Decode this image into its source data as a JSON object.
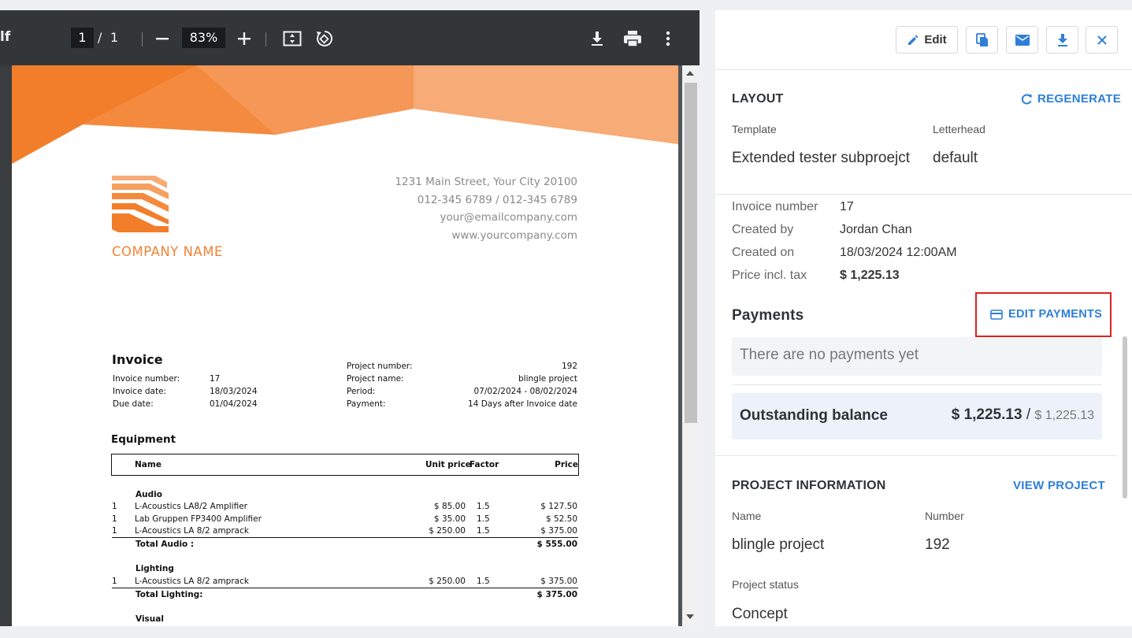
{
  "pdf_toolbar": {
    "filename_fragment": "lf",
    "page_current": "1",
    "page_separator": "/",
    "page_total": "1",
    "zoom": "83%",
    "icons": [
      "zoom-out-icon",
      "zoom-in-icon",
      "fit-page-icon",
      "rotate-icon",
      "download-icon",
      "print-icon",
      "more-options-icon"
    ]
  },
  "document": {
    "address_lines": [
      "1231 Main Street, Your City 20100",
      "012-345 6789 / 012-345 6789",
      "your@emailcompany.com",
      "www.yourcompany.com"
    ],
    "company_name": "COMPANY NAME",
    "invoice_title": "Invoice",
    "meta_left": [
      {
        "label": "Invoice number:",
        "value": "17"
      },
      {
        "label": "Invoice date:",
        "value": "18/03/2024"
      },
      {
        "label": "Due date:",
        "value": "01/04/2024"
      }
    ],
    "meta_right": [
      {
        "label": "Project number:",
        "value": "192"
      },
      {
        "label": "Project name:",
        "value": "blingle project"
      },
      {
        "label": "Period:",
        "value": "07/02/2024 - 08/02/2024"
      },
      {
        "label": "Payment:",
        "value": "14 Days after Invoice date"
      }
    ],
    "section_title": "Equipment",
    "table_headers": {
      "name": "Name",
      "unit_price": "Unit price",
      "factor": "Factor",
      "price": "Price"
    },
    "groups": [
      {
        "title": "Audio",
        "rows": [
          {
            "qty": "1",
            "name": "L-Acoustics LA8/2 Amplifier",
            "unit_price": "$ 85.00",
            "factor": "1.5",
            "price": "$ 127.50"
          },
          {
            "qty": "1",
            "name": "Lab Gruppen FP3400 Amplifier",
            "unit_price": "$ 35.00",
            "factor": "1.5",
            "price": "$ 52.50"
          },
          {
            "qty": "1",
            "name": "L-Acoustics LA 8/2 amprack",
            "unit_price": "$ 250.00",
            "factor": "1.5",
            "price": "$ 375.00"
          }
        ],
        "total_label": "Total Audio :",
        "total_value": "$ 555.00"
      },
      {
        "title": "Lighting",
        "rows": [
          {
            "qty": "1",
            "name": "L-Acoustics LA 8/2 amprack",
            "unit_price": "$ 250.00",
            "factor": "1.5",
            "price": "$ 375.00"
          }
        ],
        "total_label": "Total Lighting:",
        "total_value": "$ 375.00"
      },
      {
        "title": "Visual"
      }
    ]
  },
  "panel": {
    "buttons": {
      "edit": "Edit"
    },
    "layout": {
      "title": "LAYOUT",
      "regenerate": "REGENERATE",
      "template_label": "Template",
      "template_value": "Extended tester subproejct",
      "letterhead_label": "Letterhead",
      "letterhead_value": "default"
    },
    "details": [
      {
        "label": "Invoice number",
        "value": "17"
      },
      {
        "label": "Created by",
        "value": "Jordan Chan"
      },
      {
        "label": "Created on",
        "value": "18/03/2024 12:00AM"
      },
      {
        "label": "Price incl. tax",
        "value": "$ 1,225.13"
      }
    ],
    "payments": {
      "title": "Payments",
      "edit_payments": "EDIT PAYMENTS",
      "empty_text": "There are no payments yet",
      "outstanding_label": "Outstanding balance",
      "outstanding_amount": "$ 1,225.13",
      "outstanding_separator": "/",
      "outstanding_total": "$ 1,225.13"
    },
    "project": {
      "title": "PROJECT INFORMATION",
      "view_project": "VIEW PROJECT",
      "name_label": "Name",
      "name_value": "blingle project",
      "number_label": "Number",
      "number_value": "192",
      "status_label": "Project status",
      "status_value": "Concept"
    },
    "colors": {
      "accent": "#2d7fd8",
      "brand_orange": "#f08335",
      "highlight_red": "#e02020"
    }
  }
}
